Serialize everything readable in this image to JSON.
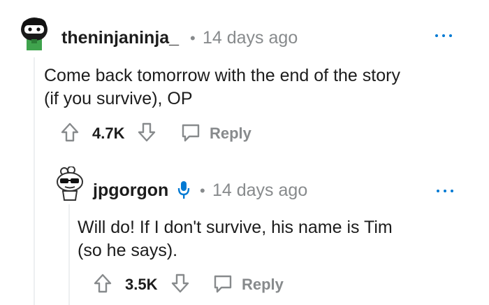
{
  "comments": [
    {
      "username": "theninjaninja_",
      "separator": "•",
      "timestamp": "14 days ago",
      "more_icon": "ellipsis-icon",
      "body_lines": [
        "Come back tomorrow with the end of the story",
        "(if you survive), OP"
      ],
      "upvotes": "4.7K",
      "reply_label": "Reply",
      "avatar": "ninja-avatar"
    },
    {
      "username": "jpgorgon",
      "separator": "•",
      "timestamp": "14 days ago",
      "more_icon": "ellipsis-icon",
      "mic_icon": "microphone-icon",
      "body_lines": [
        "Will do! If I don't survive, his name is Tim",
        "(so he says)."
      ],
      "upvotes": "3.5K",
      "reply_label": "Reply",
      "avatar": "sunglasses-avatar"
    }
  ],
  "colors": {
    "accent": "#0079d3",
    "muted": "#878a8c",
    "text": "#1c1c1c"
  }
}
